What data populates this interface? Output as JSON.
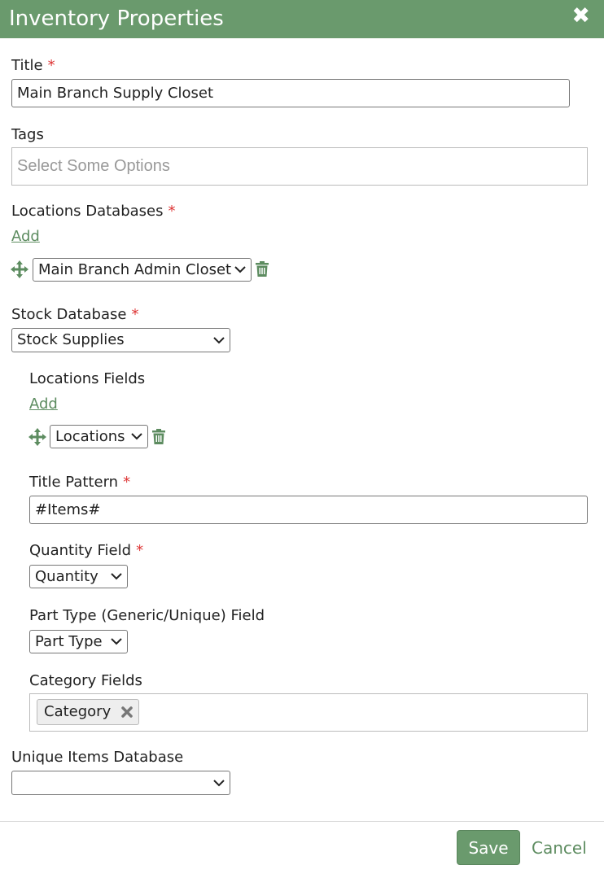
{
  "header": {
    "title": "Inventory Properties",
    "close_glyph": "✖"
  },
  "required_mark": "*",
  "title_field": {
    "label": "Title",
    "value": "Main Branch Supply Closet"
  },
  "tags": {
    "label": "Tags",
    "placeholder": "Select Some Options"
  },
  "locations_databases": {
    "label": "Locations Databases",
    "add_label": "Add",
    "items": [
      {
        "selected": "Main Branch Admin Closet"
      }
    ]
  },
  "stock_database": {
    "label": "Stock Database",
    "selected": "Stock Supplies",
    "locations_fields": {
      "label": "Locations Fields",
      "add_label": "Add",
      "items": [
        {
          "selected": "Locations"
        }
      ]
    },
    "title_pattern": {
      "label": "Title Pattern",
      "value": "#Items#"
    },
    "quantity_field": {
      "label": "Quantity Field",
      "selected": "Quantity"
    },
    "part_type_field": {
      "label": "Part Type (Generic/Unique) Field",
      "selected": "Part Type"
    },
    "category_fields": {
      "label": "Category Fields",
      "chips": [
        {
          "label": "Category",
          "remove_glyph": "✖"
        }
      ]
    }
  },
  "unique_items_database": {
    "label": "Unique Items Database",
    "selected": ""
  },
  "footer": {
    "save_label": "Save",
    "cancel_label": "Cancel"
  },
  "colors": {
    "header_bg": "#6a9a6d",
    "accent": "#5d8c60",
    "required": "#d33333"
  },
  "icons": [
    "close-icon",
    "move-icon",
    "trash-icon",
    "chevron-down-icon",
    "remove-chip-icon"
  ]
}
